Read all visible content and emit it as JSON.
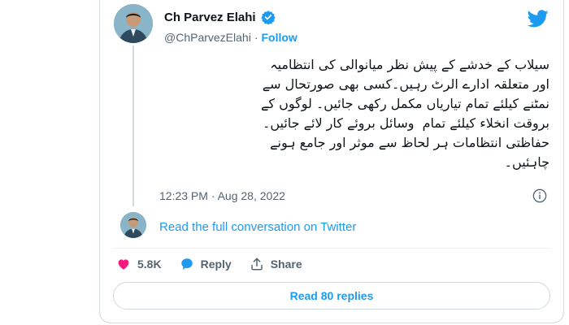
{
  "author": {
    "name": "Ch Parvez Elahi",
    "handle": "@ChParvezElahi",
    "separator": "·",
    "follow_label": "Follow"
  },
  "tweet": {
    "text_lines": [
      "سیلاب کے خدشے کے پیش نظر میانوالی کی انتظامیہ",
      "اور متعلقہ ادارے الرٹ رہیں۔کسی بھی صورتحال سے",
      "نمٹنے کیلئے تمام تیاریاں مکمل رکھی جائیں۔ لوگوں کے",
      "بروقت انخلاء کیلئے تمام  وسائل بروئے کار لائے جائیں۔",
      "حفاظتی انتظامات ہر لحاظ سے موثر اور جامع ہونے",
      "چاہئیں۔"
    ],
    "timestamp": "12:23 PM · Aug 28, 2022"
  },
  "conversation_link": "Read the full conversation on Twitter",
  "actions": {
    "like_count": "5.8K",
    "reply_label": "Reply",
    "share_label": "Share"
  },
  "read_replies_label": "Read 80 replies",
  "colors": {
    "accent": "#1d9bf0",
    "like": "#f91880",
    "text": "#0f1419",
    "muted": "#536471",
    "border": "#cfd9de"
  },
  "icons": [
    "verified-badge-icon",
    "twitter-bird-icon",
    "info-icon",
    "heart-icon",
    "reply-bubble-icon",
    "share-icon"
  ]
}
